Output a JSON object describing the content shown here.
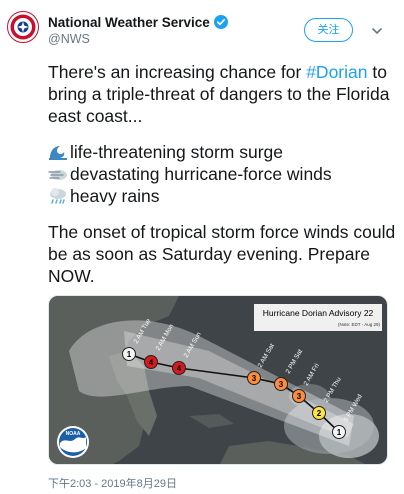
{
  "author": {
    "name": "National Weather Service",
    "handle": "@NWS"
  },
  "follow_label": "关注",
  "tweet": {
    "intro_text": "There's an increasing chance for ",
    "hashtag": "#Dorian",
    "intro_rest": " to bring a triple-threat of dangers to the Florida east coast...",
    "threats": [
      {
        "icon": "wave-emoji",
        "text": "life-threatening storm surge"
      },
      {
        "icon": "wind-emoji",
        "text": "devastating hurricane-force winds"
      },
      {
        "icon": "rain-cloud-emoji",
        "text": "heavy rains"
      }
    ],
    "closing_text": "The onset of tropical storm force winds could be as soon as Saturday evening. Prepare NOW."
  },
  "map": {
    "title": "Hurricane Dorian Advisory 22",
    "subtitle": "(Note: EDT - Aug 29)",
    "logo_text": "NOAA",
    "track_points": [
      {
        "category": "1",
        "color": "#f3f3f3",
        "time": "2 AM Tue"
      },
      {
        "category": "4",
        "color": "#d7191c",
        "time": "2 AM Mon"
      },
      {
        "category": "4",
        "color": "#d7191c",
        "time": "2 AM Sun"
      },
      {
        "category": "3",
        "color": "#fd8d3c",
        "time": "2 AM Sat"
      },
      {
        "category": "3",
        "color": "#fd8d3c",
        "time": "2 PM Sat"
      },
      {
        "category": "3",
        "color": "#fd8d3c",
        "time": "2 AM Fri"
      },
      {
        "category": "2",
        "color": "#fee440",
        "time": "2 PM Thu"
      },
      {
        "category": "1",
        "color": "#f3f3f3",
        "time": "5 PM Wed"
      }
    ]
  },
  "timestamp": "下午2:03 - 2019年8月29日",
  "colors": {
    "accent": "#1da1f2",
    "secondary_text": "#657786"
  }
}
